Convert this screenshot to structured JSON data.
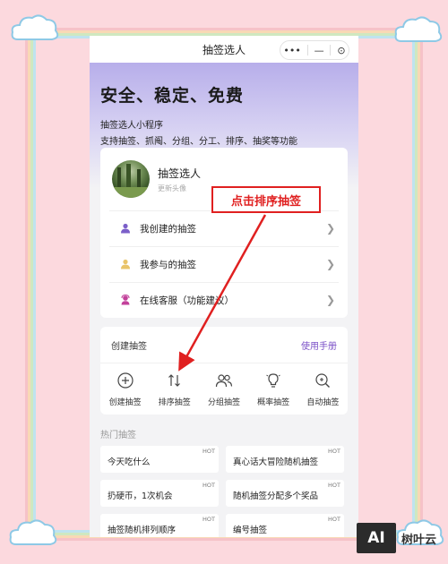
{
  "navbar": {
    "title": "抽签选人",
    "capsule_more": "•••",
    "capsule_min": "—",
    "capsule_close": "⊙"
  },
  "hero": {
    "title": "安全、稳定、免费",
    "subtitle1": "抽签选人小程序",
    "subtitle2": "支持抽签、抓阄、分组、分工、排序、抽奖等功能"
  },
  "user": {
    "name": "抽签选人",
    "update_avatar": "更新头像"
  },
  "menu": [
    {
      "label": "我创建的抽签",
      "icon": "user-icon",
      "color": "#7b5fc9"
    },
    {
      "label": "我参与的抽签",
      "icon": "user-icon",
      "color": "#e9c46a"
    },
    {
      "label": "在线客服（功能建议）",
      "icon": "service-icon",
      "color": "#c2409a"
    }
  ],
  "create": {
    "title": "创建抽签",
    "manual": "使用手册",
    "tools": [
      {
        "label": "创建抽签",
        "icon": "plus-circle-icon"
      },
      {
        "label": "排序抽签",
        "icon": "sort-icon"
      },
      {
        "label": "分组抽签",
        "icon": "group-icon"
      },
      {
        "label": "概率抽签",
        "icon": "bulb-icon"
      },
      {
        "label": "自动抽签",
        "icon": "auto-icon"
      }
    ]
  },
  "hot": {
    "title": "热门抽签",
    "tag": "HOT",
    "items": [
      "今天吃什么",
      "真心话大冒险随机抽签",
      "扔硬币，1次机会",
      "随机抽签分配多个奖品",
      "抽签随机排列顺序",
      "编号抽签"
    ]
  },
  "annotation": {
    "callout": "点击排序抽签",
    "color": "#e02020"
  },
  "watermark": {
    "logo": "AI",
    "text": "树叶云"
  }
}
